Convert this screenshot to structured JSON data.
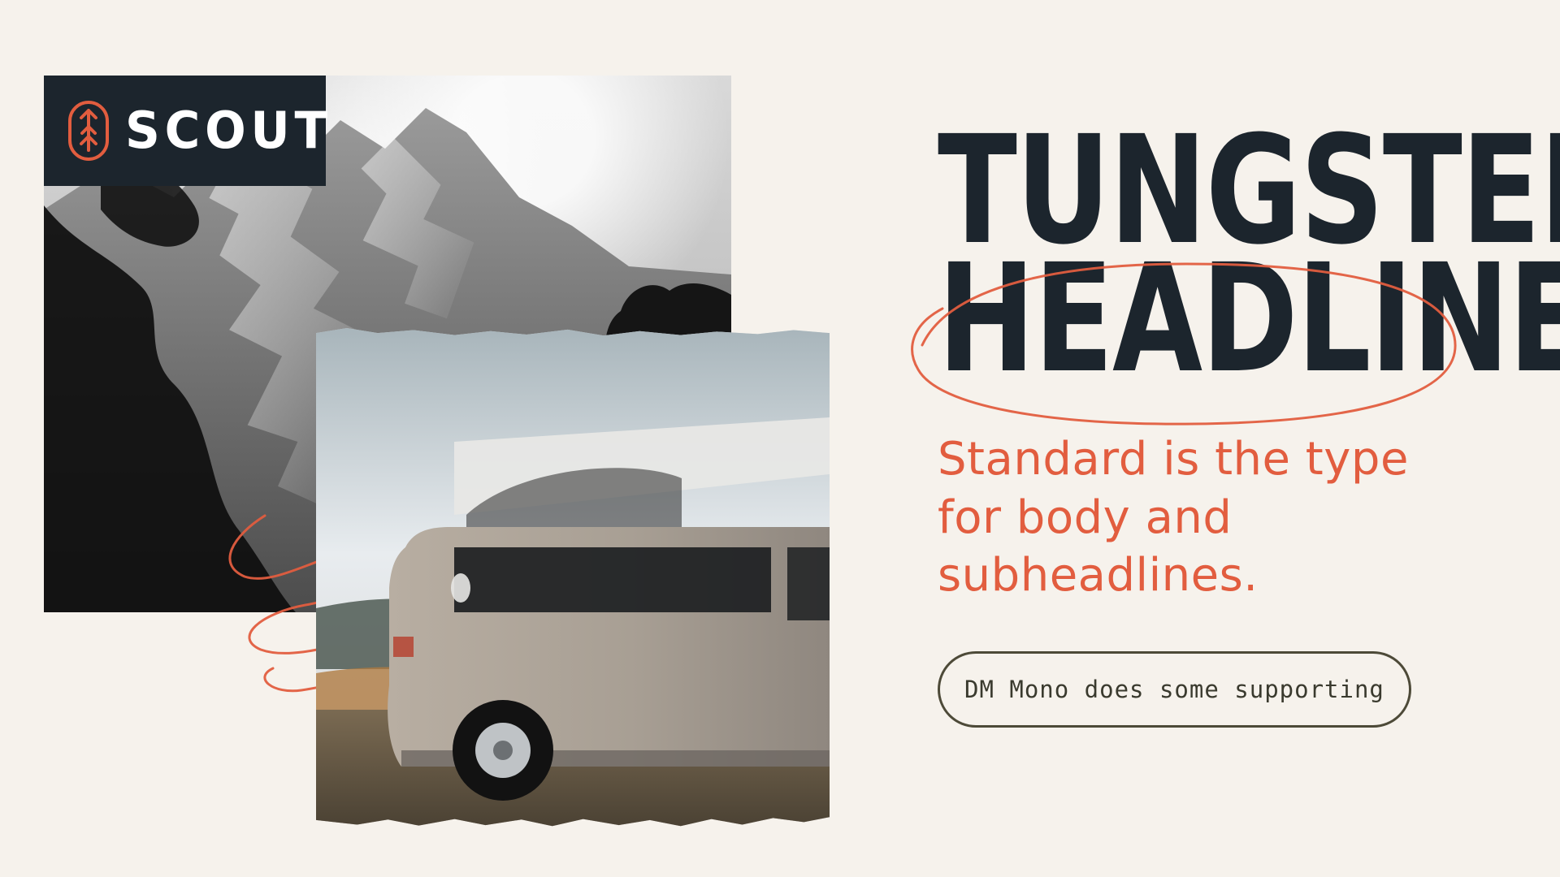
{
  "colors": {
    "background": "#f6f2ec",
    "ink": "#1c252d",
    "accent": "#e25d3f",
    "muted_olive": "#4d4a38"
  },
  "brand": {
    "logo_text": "SCOUT",
    "logo_icon": "tree-arrow-icon"
  },
  "typography": {
    "headline_line_1": "TUNGSTEN",
    "headline_line_2": "HEADLINE",
    "subheadline": "Standard is the type for body and subheadlines.",
    "supporting_pill": "DM Mono does some supporting"
  }
}
